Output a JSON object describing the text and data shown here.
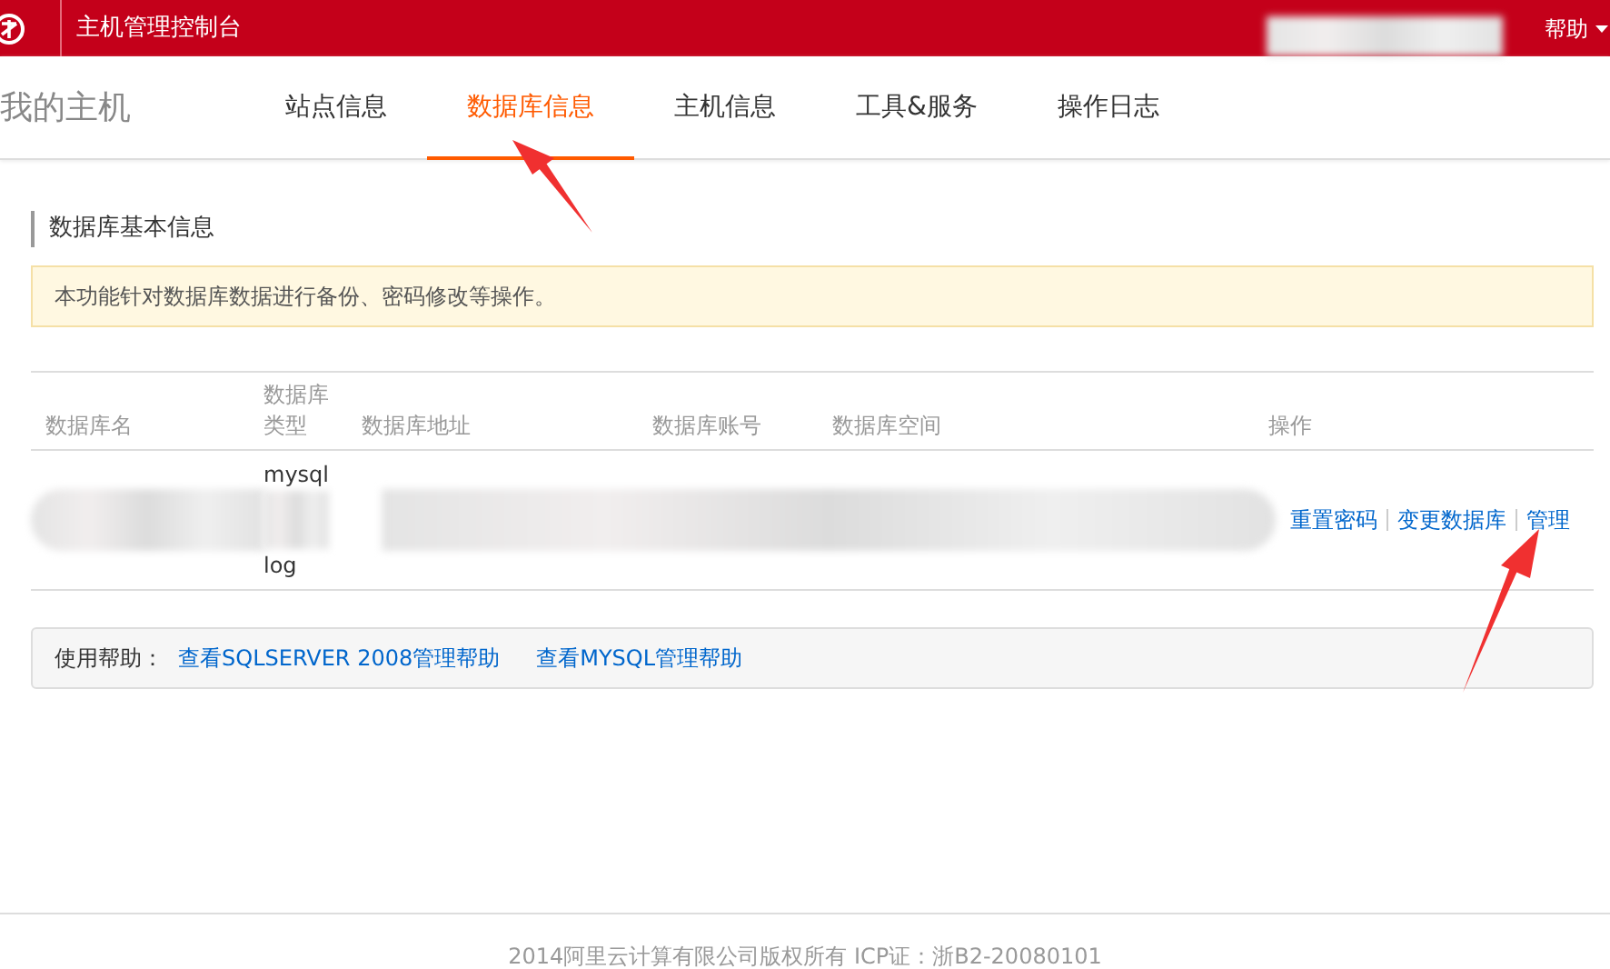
{
  "topbar": {
    "title": "主机管理控制台",
    "help": "帮助"
  },
  "nav": {
    "brand": "我的主机",
    "tabs": [
      {
        "label": "站点信息",
        "selected": false
      },
      {
        "label": "数据库信息",
        "selected": true
      },
      {
        "label": "主机信息",
        "selected": false
      },
      {
        "label": "工具&服务",
        "selected": false
      },
      {
        "label": "操作日志",
        "selected": false
      }
    ]
  },
  "section_title": "数据库基本信息",
  "notice": "本功能针对数据库数据进行备份、密码修改等操作。",
  "table": {
    "columns": [
      "数据库名",
      "数据库类型",
      "数据库地址",
      "数据库账号",
      "数据库空间",
      "操作"
    ],
    "rows": [
      {
        "type_top": "mysql",
        "type_bottom": "log",
        "actions": [
          "重置密码",
          "变更数据库",
          "管理"
        ]
      }
    ]
  },
  "help_bar": {
    "label": "使用帮助：",
    "links": [
      "查看SQLSERVER 2008管理帮助",
      "查看MYSQL管理帮助"
    ]
  },
  "footer": "2014阿里云计算有限公司版权所有 ICP证：浙B2-20080101"
}
